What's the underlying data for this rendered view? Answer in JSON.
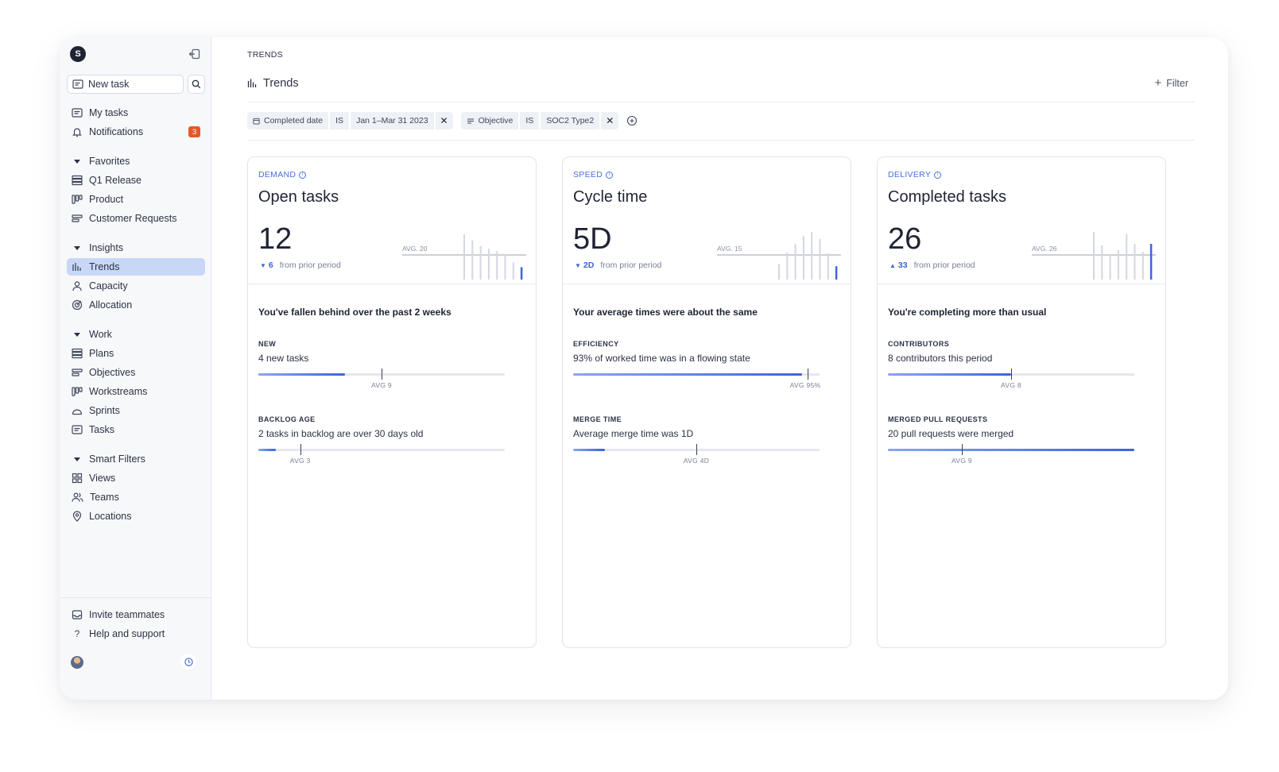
{
  "sidebar": {
    "logo": "S",
    "new_task": "New task",
    "items": {
      "my_tasks": "My tasks",
      "notifications": "Notifications",
      "notifications_count": "3",
      "favorites": "Favorites",
      "q1_release": "Q1 Release",
      "product": "Product",
      "customer_requests": "Customer Requests",
      "insights": "Insights",
      "trends": "Trends",
      "capacity": "Capacity",
      "allocation": "Allocation",
      "work": "Work",
      "plans": "Plans",
      "objectives": "Objectives",
      "workstreams": "Workstreams",
      "sprints": "Sprints",
      "tasks": "Tasks",
      "smart_filters": "Smart Filters",
      "views": "Views",
      "teams": "Teams",
      "locations": "Locations",
      "invite": "Invite teammates",
      "help": "Help and support"
    }
  },
  "main": {
    "breadcrumb": "TRENDS",
    "title": "Trends",
    "filter_label": "Filter",
    "filters": [
      {
        "field": "Completed date",
        "op": "IS",
        "value": "Jan 1–Mar 31 2023",
        "icon": "calendar-icon"
      },
      {
        "field": "Objective",
        "op": "IS",
        "value": "SOC2 Type2",
        "icon": "objective-icon"
      }
    ],
    "remove_symbol": "✕"
  },
  "cards": [
    {
      "category": "DEMAND",
      "title": "Open tasks",
      "value": "12",
      "delta_dir": "down",
      "delta_arrow": "▼",
      "delta": "6",
      "delta_text": "from prior period",
      "avg_label": "AVG. 20",
      "spark": [
        0.95,
        0.82,
        0.7,
        0.65,
        0.6,
        0.5,
        0.36,
        0.26
      ],
      "summary": "You've fallen behind over the past 2 weeks",
      "metrics": [
        {
          "label": "NEW",
          "text": "4 new tasks",
          "fill": 0.35,
          "avg": 0.5,
          "avg_label": "AVG 9"
        },
        {
          "label": "BACKLOG AGE",
          "text": "2 tasks in backlog are over 30 days old",
          "fill": 0.07,
          "avg": 0.17,
          "avg_label": "AVG 3"
        }
      ]
    },
    {
      "category": "SPEED",
      "title": "Cycle time",
      "value": "5D",
      "delta_dir": "down",
      "delta_arrow": "▼",
      "delta": "2D",
      "delta_text": "from prior period",
      "avg_label": "AVG. 15",
      "spark": [
        0.33,
        0.57,
        0.75,
        0.92,
        1.0,
        0.85,
        0.55,
        0.28
      ],
      "summary": "Your average times were about the same",
      "metrics": [
        {
          "label": "EFFICIENCY",
          "text": "93% of worked time was in a flowing state",
          "fill": 0.93,
          "avg": 0.95,
          "avg_label": "AVG 95%"
        },
        {
          "label": "MERGE TIME",
          "text": "Average merge time was 1D",
          "fill": 0.13,
          "avg": 0.5,
          "avg_label": "AVG 4D"
        }
      ]
    },
    {
      "category": "DELIVERY",
      "title": "Completed tasks",
      "value": "26",
      "delta_dir": "up",
      "delta_arrow": "▲",
      "delta": "33",
      "delta_text": "from prior period",
      "avg_label": "AVG. 26",
      "spark": [
        1.0,
        0.72,
        0.5,
        0.62,
        0.95,
        0.75,
        0.58,
        0.75
      ],
      "summary": "You're completing more than usual",
      "metrics": [
        {
          "label": "CONTRIBUTORS",
          "text": "8 contributors this period",
          "fill": 0.5,
          "avg": 0.5,
          "avg_label": "AVG 8"
        },
        {
          "label": "MERGED PULL REQUESTS",
          "text": "20 pull requests were merged",
          "fill": 1.0,
          "avg": 0.3,
          "avg_label": "AVG 9"
        }
      ]
    }
  ]
}
